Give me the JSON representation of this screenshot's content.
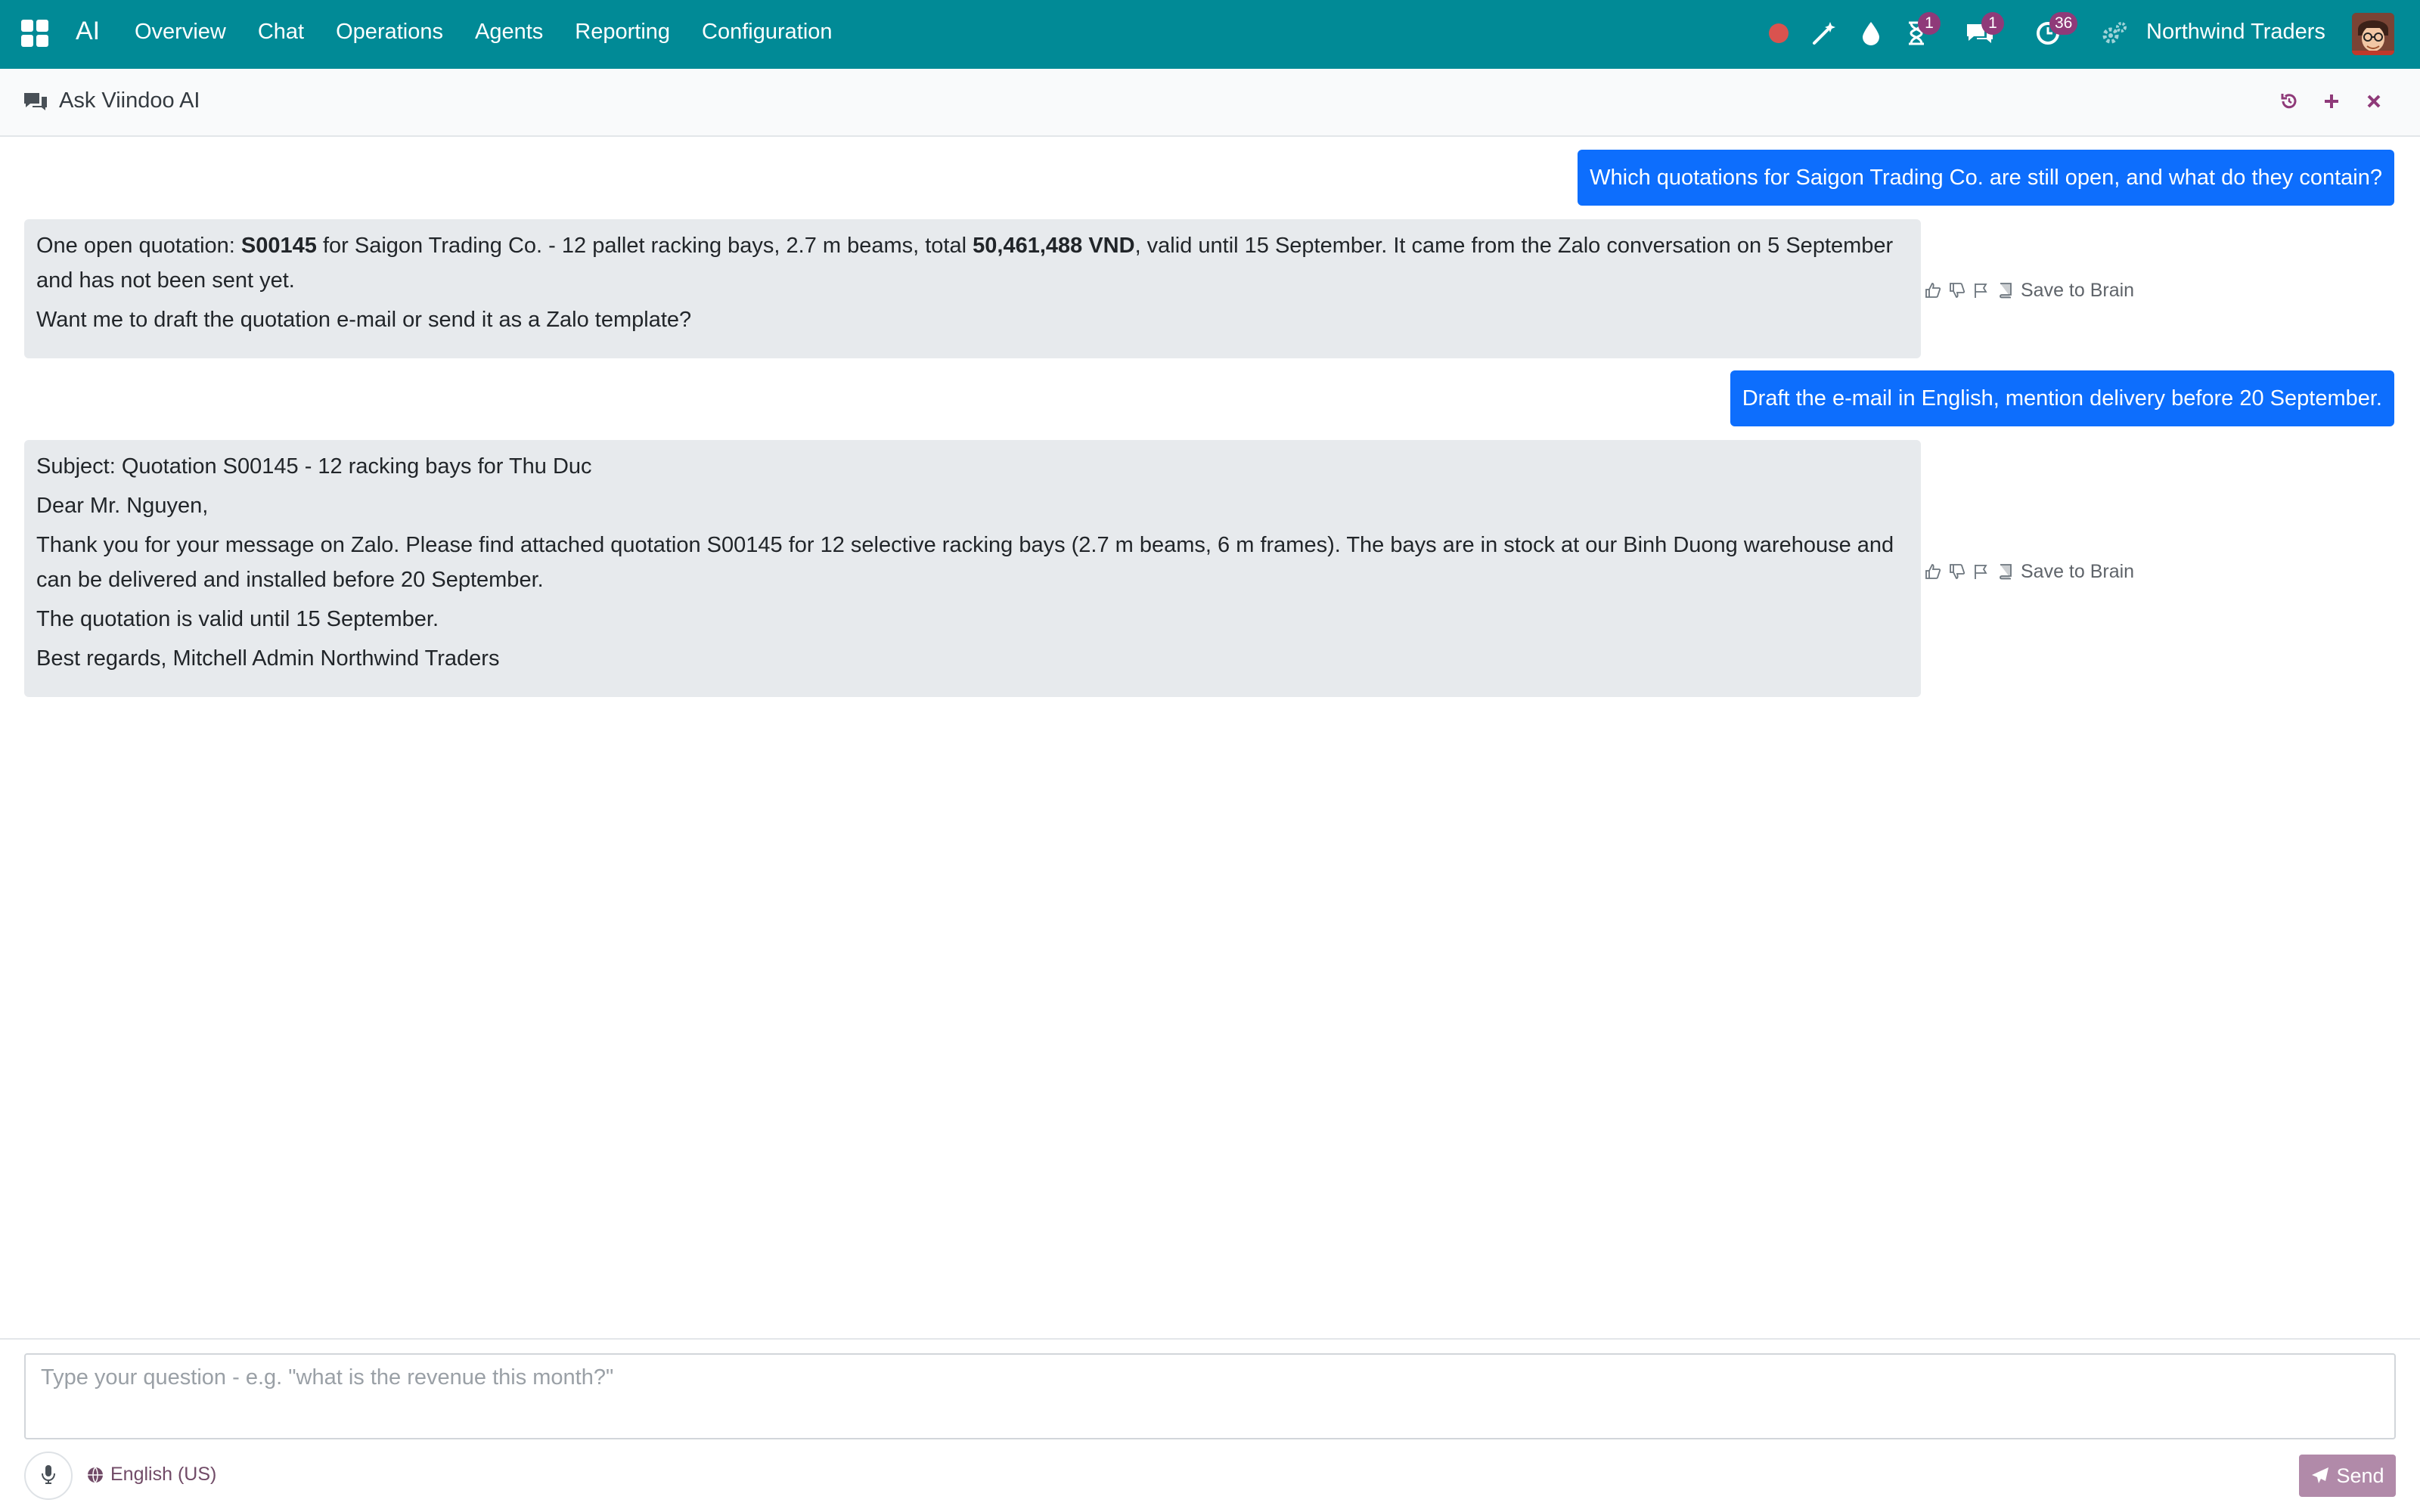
{
  "navbar": {
    "app_name": "AI",
    "menu": [
      "Overview",
      "Chat",
      "Operations",
      "Agents",
      "Reporting",
      "Configuration"
    ],
    "badges": {
      "activities": "1",
      "messages": "1",
      "clock": "36"
    },
    "company": "Northwind Traders",
    "icons": [
      "apps-grid-icon",
      "record-dot-icon",
      "magic-wand-icon",
      "droplet-icon",
      "hourglass-icon",
      "chat-bubbles-icon",
      "clock-icon",
      "settings-gears-icon"
    ],
    "colors": {
      "bar": "#018a96",
      "badge": "#8f3a79",
      "record": "#d9534f"
    }
  },
  "control_panel": {
    "title": "Ask Viindoo AI",
    "actions": [
      "history-icon",
      "plus-icon",
      "close-icon"
    ],
    "action_color": "#8f3a79"
  },
  "messages": [
    {
      "role": "user",
      "text": "Which quotations for Saigon Trading Co. are still open, and what do they contain?"
    },
    {
      "role": "assistant",
      "p1_a": "One open quotation: ",
      "p1_b": "S00145",
      "p1_c": " for Saigon Trading Co. - 12 pallet racking bays, 2.7 m beams, total ",
      "p1_d": "50,461,488 VND",
      "p1_e": ", valid until 15 September. It came from the Zalo conversation on 5 September and has not been sent yet.",
      "p2": "Want me to draft the quotation e-mail or send it as a Zalo template?",
      "save_label": "Save to Brain"
    },
    {
      "role": "user",
      "text": "Draft the e-mail in English, mention delivery before 20 September."
    },
    {
      "role": "assistant",
      "paragraphs": [
        "Subject: Quotation S00145 - 12 racking bays for Thu Duc",
        "Dear Mr. Nguyen,",
        "Thank you for your message on Zalo. Please find attached quotation S00145 for 12 selective racking bays (2.7 m beams, 6 m frames). The bays are in stock at our Binh Duong warehouse and can be delivered and installed before 20 September.",
        "The quotation is valid until 15 September.",
        "Best regards, Mitchell Admin Northwind Traders"
      ],
      "save_label": "Save to Brain"
    }
  ],
  "composer": {
    "placeholder": "Type your question - e.g. \"what is the revenue this month?\"",
    "value": "",
    "language": "English (US)",
    "send_label": "Send",
    "colors": {
      "user_bubble": "#0d6efd",
      "ai_bubble": "#e7eaed",
      "send": "#b18aa9",
      "link": "#714b67"
    }
  }
}
